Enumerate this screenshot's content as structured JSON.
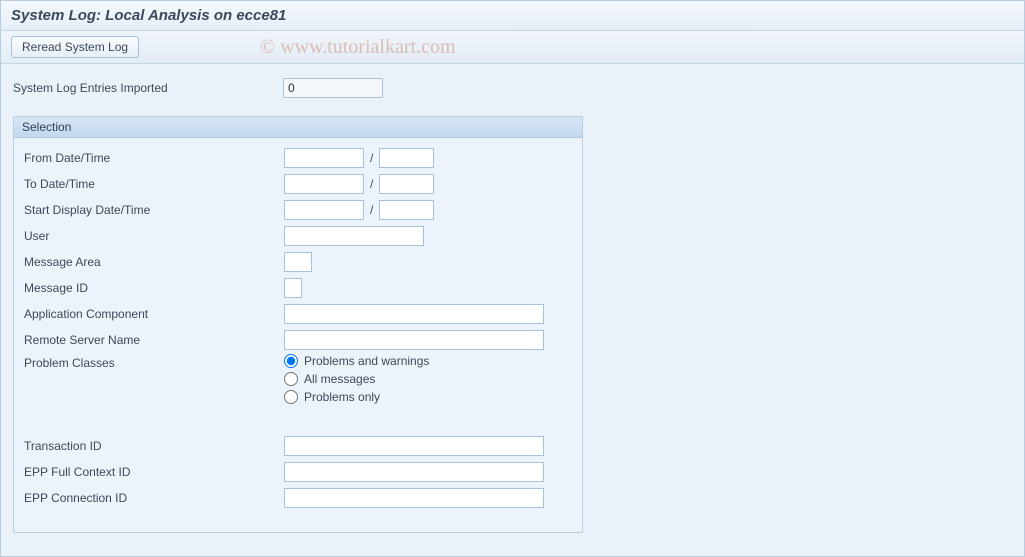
{
  "title": "System Log: Local Analysis on ecce81",
  "toolbar": {
    "reread_label": "Reread System Log"
  },
  "summary": {
    "entries_imported_label": "System Log Entries Imported",
    "entries_imported_value": "0"
  },
  "panel": {
    "header": "Selection",
    "labels": {
      "from": "From Date/Time",
      "to": "To Date/Time",
      "start_display": "Start Display  Date/Time",
      "user": "User",
      "message_area": "Message Area",
      "message_id": "Message ID",
      "app_component": "Application Component",
      "remote_server": "Remote Server Name",
      "problem_classes": "Problem Classes",
      "transaction_id": "Transaction ID",
      "epp_full": "EPP Full Context ID",
      "epp_conn": "EPP Connection ID"
    },
    "separator": "/",
    "problem_class_options": {
      "pw": "Problems and warnings",
      "all": "All messages",
      "po": "Problems only"
    },
    "values": {
      "from_date": "",
      "from_time": "",
      "to_date": "",
      "to_time": "",
      "start_date": "",
      "start_time": "",
      "user": "",
      "message_area": "",
      "message_id": "",
      "app_component": "",
      "remote_server": "",
      "transaction_id": "",
      "epp_full": "",
      "epp_conn": ""
    }
  },
  "watermark": "© www.tutorialkart.com"
}
